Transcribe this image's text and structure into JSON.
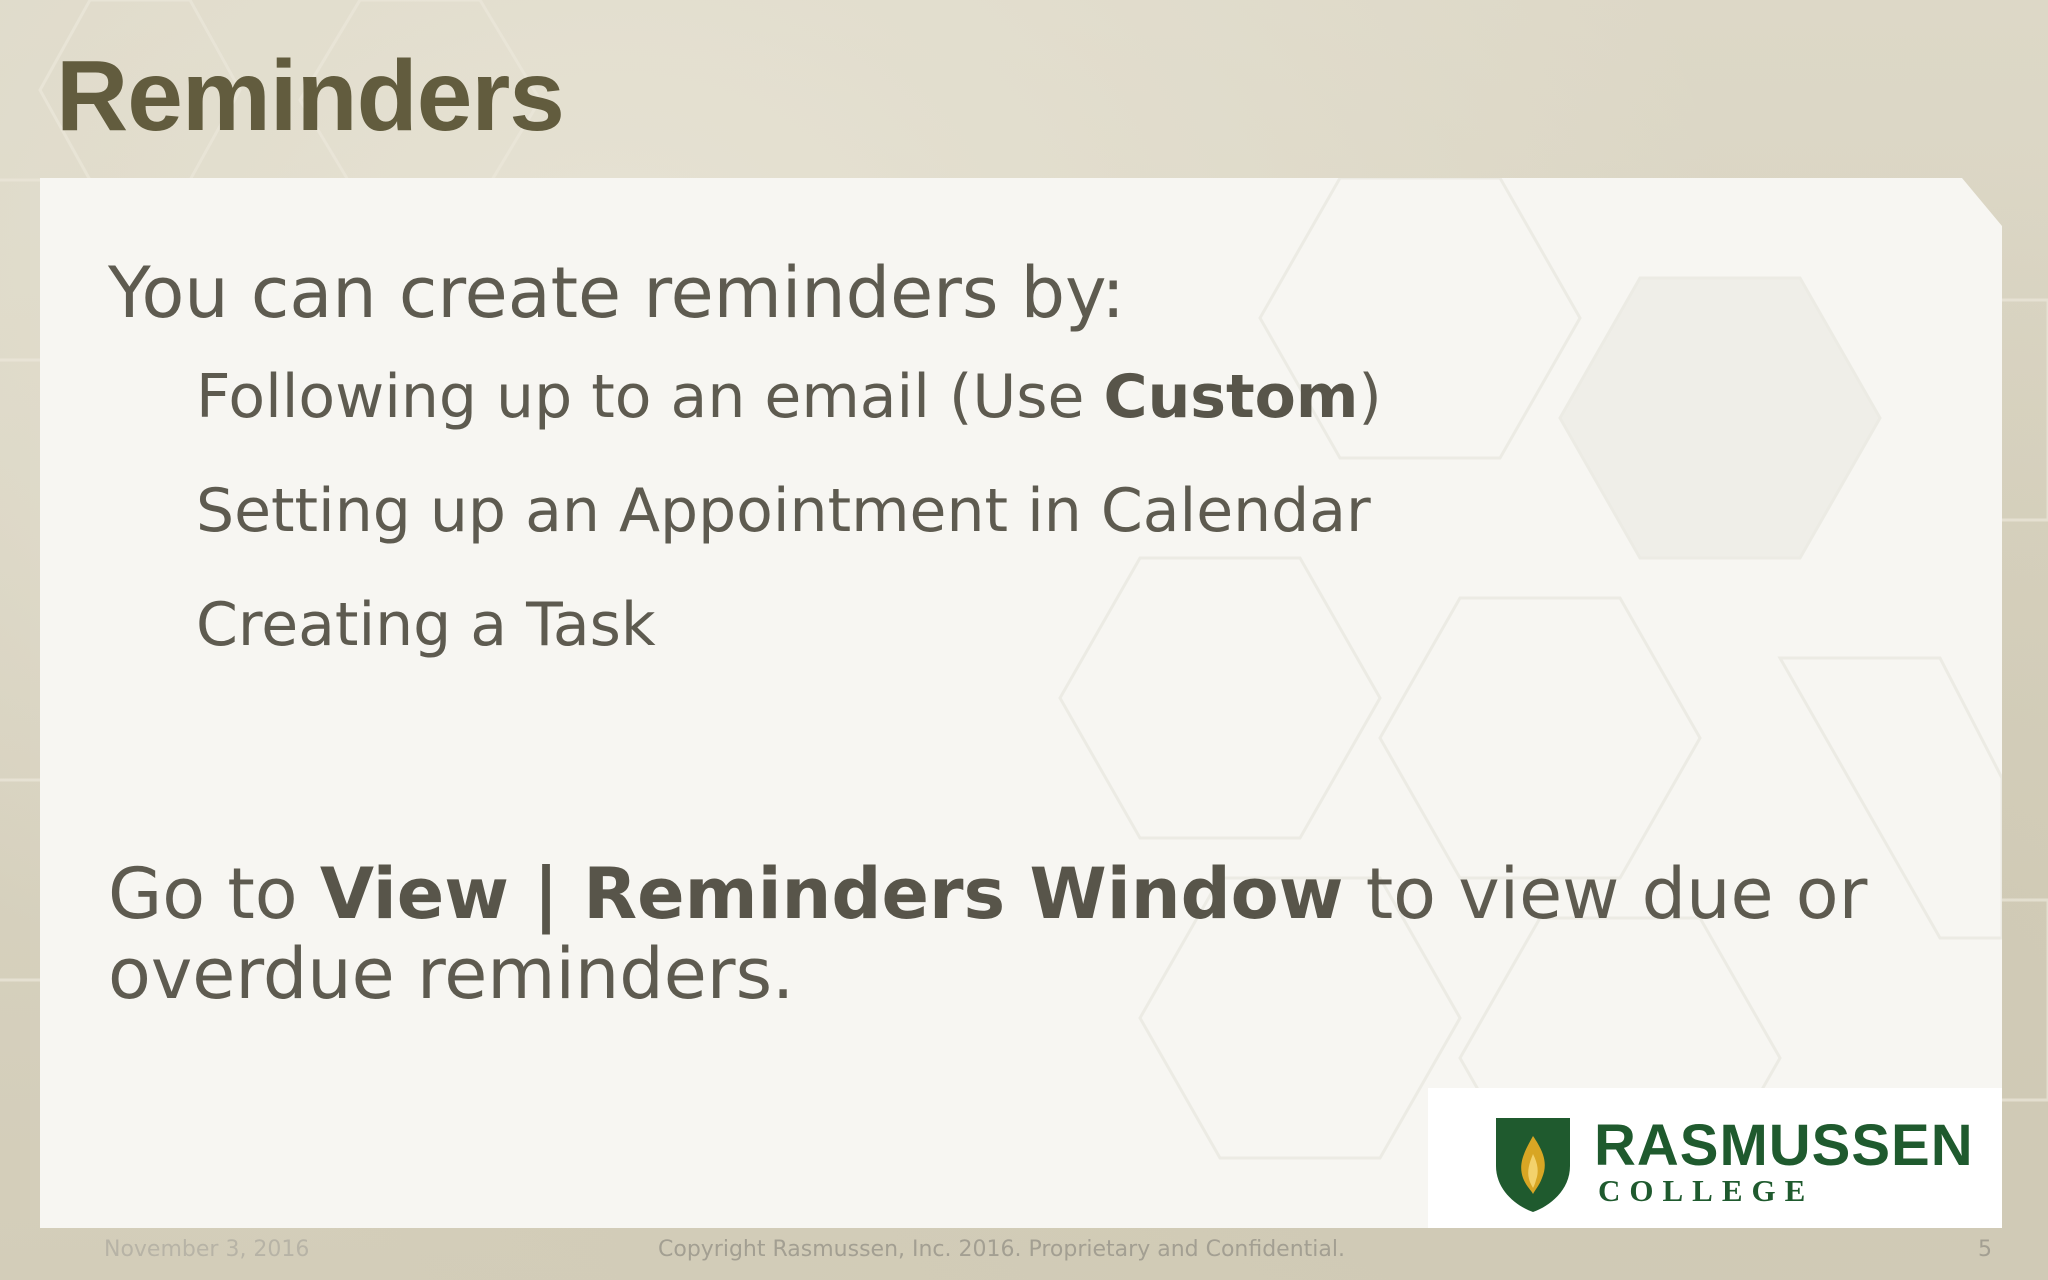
{
  "slide": {
    "title": "Reminders",
    "intro": "You can create reminders by:",
    "items": [
      {
        "text": "Following up to an email (Use ",
        "bold": "Custom",
        "after": ")"
      },
      {
        "text": "Setting up an Appointment in Calendar",
        "bold": "",
        "after": ""
      },
      {
        "text": "Creating a Task",
        "bold": "",
        "after": ""
      }
    ],
    "goto": {
      "before": "Go to ",
      "bold": "View | Reminders Window",
      "after": " to view due or overdue reminders."
    }
  },
  "logo": {
    "name": "RASMUSSEN",
    "sub": "COLLEGE"
  },
  "footer": {
    "date": "November 3, 2016",
    "copyright": "Copyright Rasmussen, Inc. 2016. Proprietary and Confidential.",
    "page": "5"
  },
  "colors": {
    "title": "#625c3e",
    "body_text": "#5e5b50",
    "brand_green": "#1f5a2e",
    "brand_gold": "#d8a624"
  }
}
